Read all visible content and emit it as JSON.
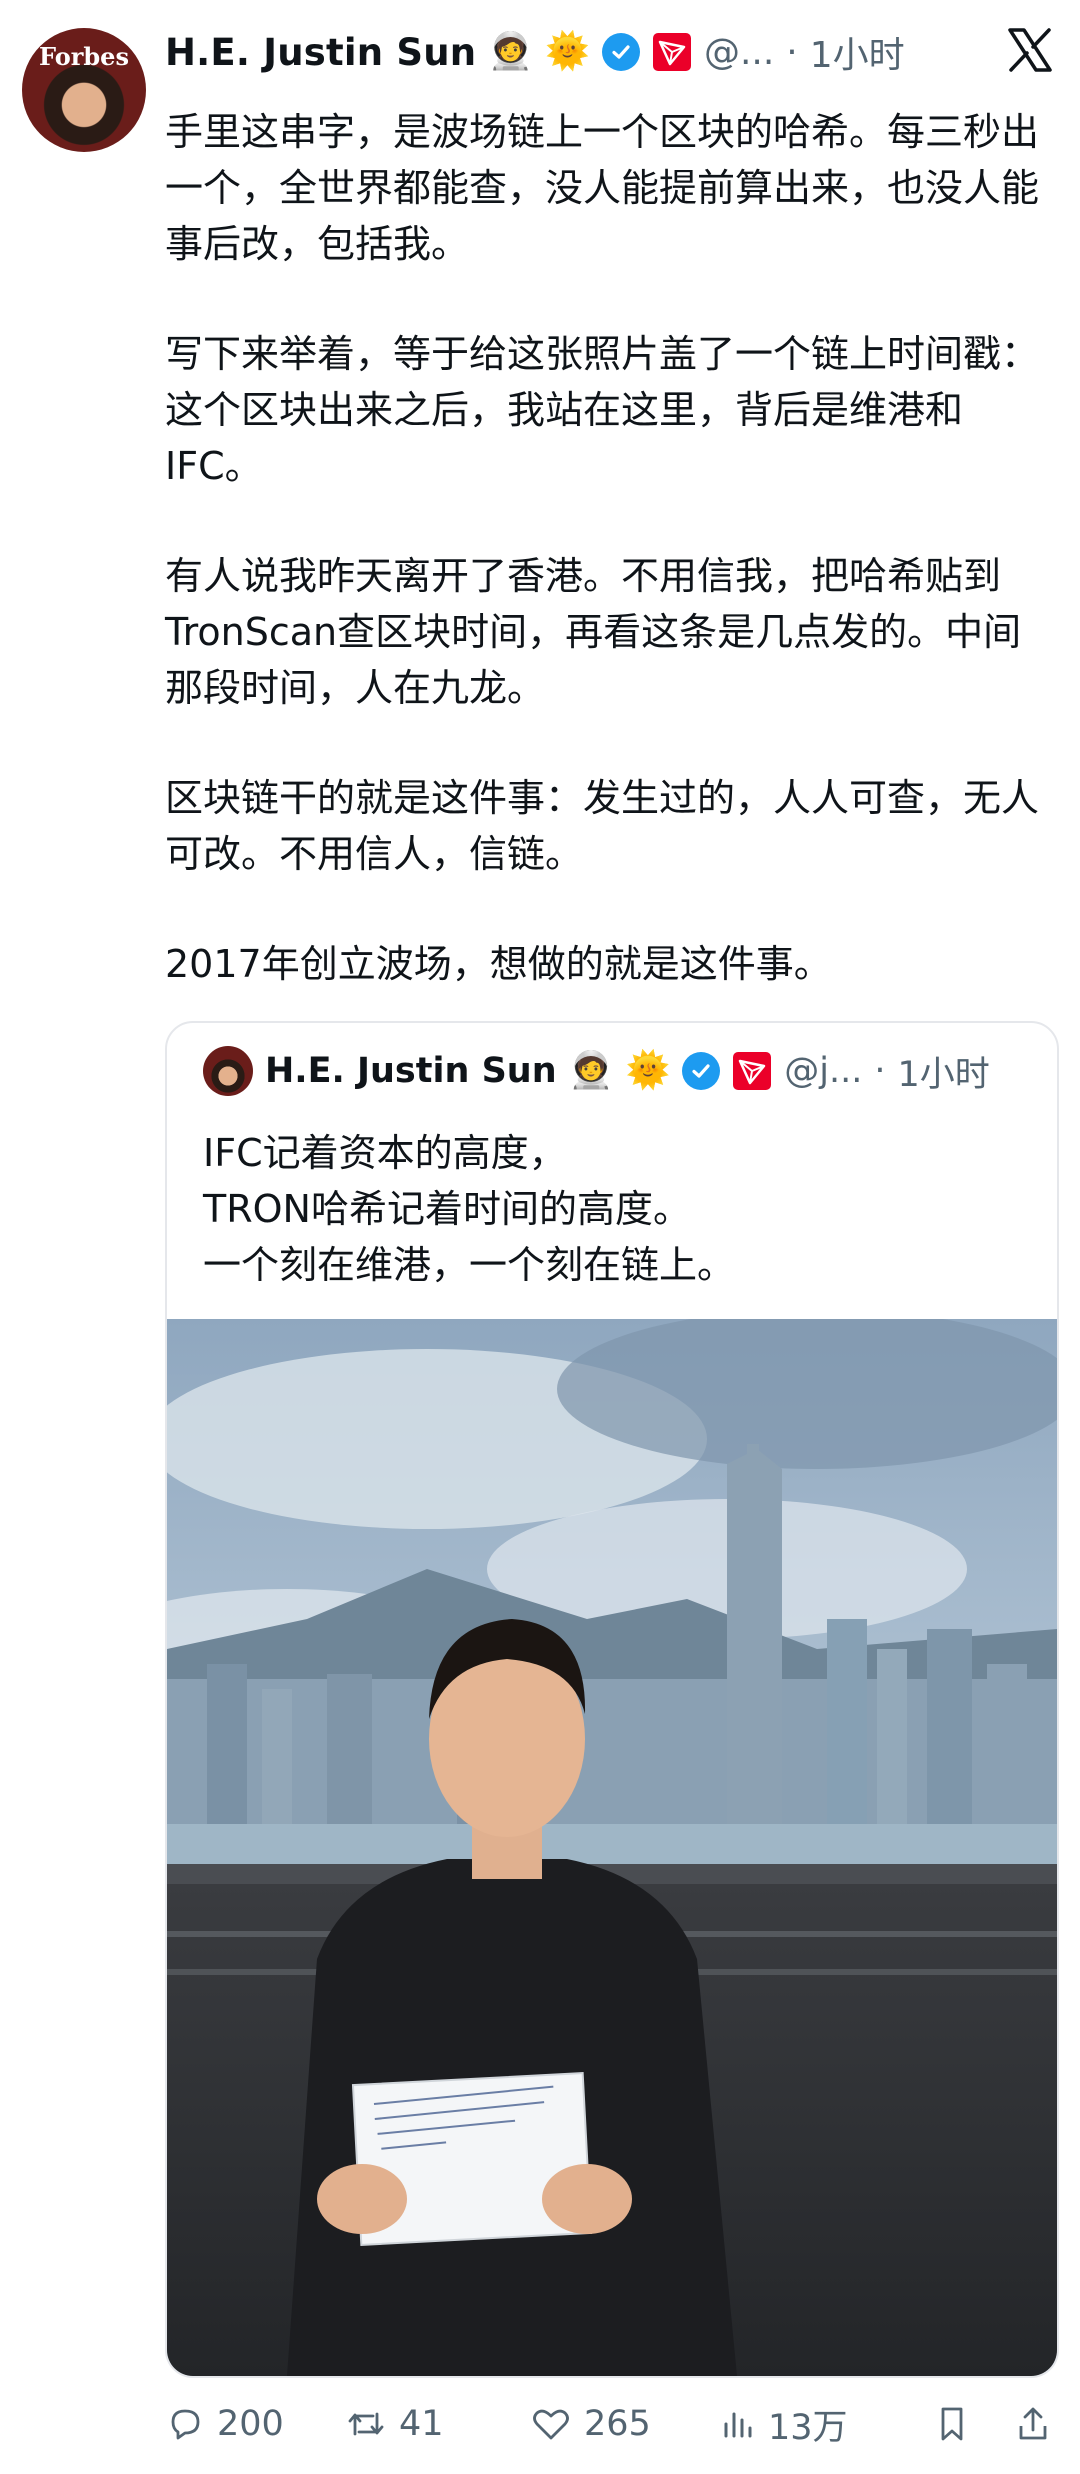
{
  "post": {
    "author_name": "H.E. Justin Sun",
    "emoji_1": "🧑‍🚀",
    "emoji_2": "🌞",
    "handle": "@...",
    "dot": "·",
    "time": "1小时",
    "paragraphs": [
      "手里这串字，是波场链上一个区块的哈希。每三秒出一个，全世界都能查，没人能提前算出来，也没人能事后改，包括我。",
      "写下来举着，等于给这张照片盖了一个链上时间戳：这个区块出来之后，我站在这里，背后是维港和IFC。",
      "有人说我昨天离开了香港。不用信我，把哈希贴到TronScan查区块时间，再看这条是几点发的。中间那段时间，人在九龙。",
      "区块链干的就是这件事：发生过的，人人可查，无人可改。不用信人，信链。",
      "2017年创立波场，想做的就是这件事。"
    ],
    "avatar_brand": "Forbes"
  },
  "quote": {
    "author_name": "H.E. Justin Sun",
    "emoji_1": "🧑‍🚀",
    "emoji_2": "🌞",
    "handle": "@j...",
    "dot": "·",
    "time": "1小时",
    "text": "IFC记着资本的高度，\nTRON哈希记着时间的高度。\n一个刻在维港，一个刻在链上。"
  },
  "actions": {
    "replies": "200",
    "reposts": "41",
    "likes": "265",
    "views": "13万"
  },
  "colors": {
    "accent": "#1d9bf0",
    "tron_red": "#eb0029",
    "muted": "#536471"
  }
}
